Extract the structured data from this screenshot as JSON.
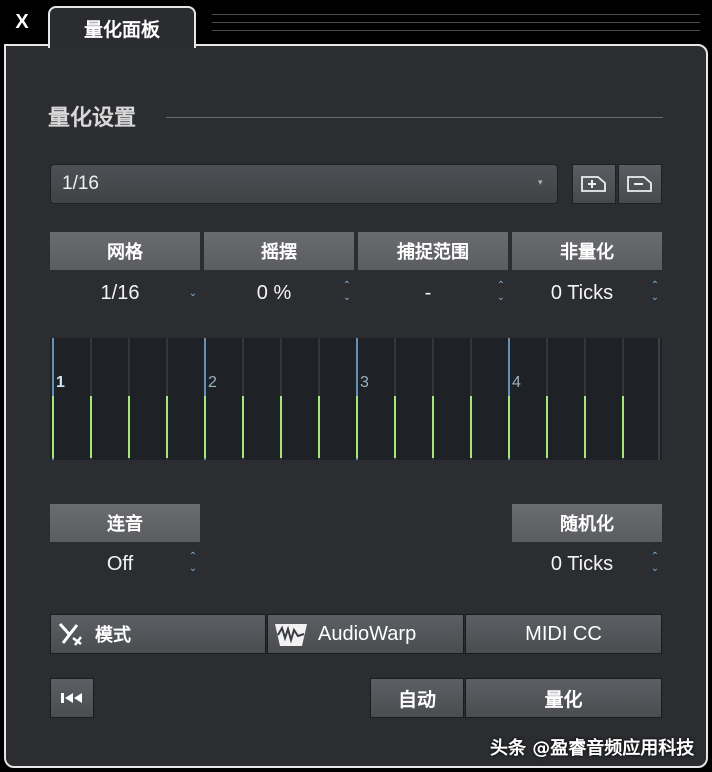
{
  "window": {
    "close_label": "X",
    "tab_title": "量化面板"
  },
  "section": {
    "title": "量化设置"
  },
  "preset": {
    "value": "1/16",
    "arrow_icon": "chevron-down-icon"
  },
  "params": [
    {
      "label": "网格",
      "value": "1/16"
    },
    {
      "label": "摇摆",
      "value": "0 %"
    },
    {
      "label": "捕捉范围",
      "value": "-"
    },
    {
      "label": "非量化",
      "value": "0 Ticks"
    }
  ],
  "grid_numbers": [
    "1",
    "2",
    "3",
    "4"
  ],
  "legato": {
    "label": "连音",
    "value": "Off"
  },
  "random": {
    "label": "随机化",
    "value": "0 Ticks"
  },
  "buttons": {
    "mode": "模式",
    "audiowarp": "AudioWarp",
    "midicc": "MIDI CC",
    "auto": "自动",
    "quantize": "量化"
  },
  "watermark": "头条 @盈睿音频应用科技",
  "colors": {
    "panel": "#2b2d30",
    "grid_green": "#a6e67a",
    "grid_blue": "#6c9cc4",
    "spinner": "#7fb0d8"
  }
}
